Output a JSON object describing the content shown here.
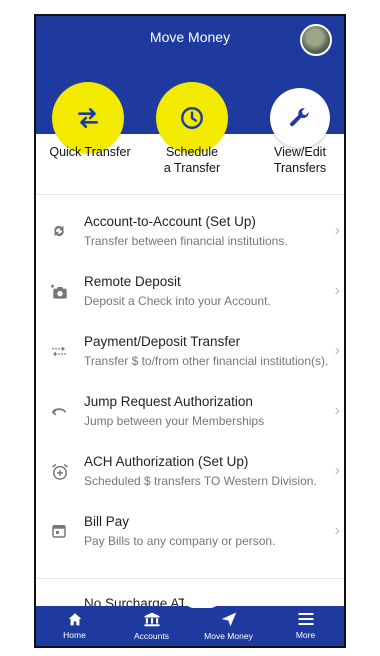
{
  "header": {
    "title": "Move Money"
  },
  "quick_actions": [
    {
      "label_line1": "Quick Transfer",
      "label_line2": "",
      "icon": "swap-arrows-icon"
    },
    {
      "label_line1": "Schedule",
      "label_line2": "a Transfer",
      "icon": "clock-icon"
    },
    {
      "label_line1": "View/Edit",
      "label_line2": "Transfers",
      "icon": "wrench-icon"
    }
  ],
  "menu": [
    {
      "title": "Account-to-Account (Set Up)",
      "subtitle": "Transfer between financial institutions.",
      "icon": "sync-arrows-icon"
    },
    {
      "title": "Remote Deposit",
      "subtitle": "Deposit a Check into your Account.",
      "icon": "camera-plus-icon"
    },
    {
      "title": "Payment/Deposit Transfer",
      "subtitle": "Transfer $ to/from other financial institution(s).",
      "icon": "dotted-swap-icon"
    },
    {
      "title": "Jump Request Authorization",
      "subtitle": "Jump between your Memberships",
      "icon": "jump-arrow-icon"
    },
    {
      "title": "ACH Authorization (Set Up)",
      "subtitle": "Scheduled $ transfers TO Western Division.",
      "icon": "alarm-plus-icon"
    },
    {
      "title": "Bill Pay",
      "subtitle": "Pay Bills to any company or person.",
      "icon": "calendar-icon"
    }
  ],
  "partial_item": "No Surcharge ATMs",
  "tabs": [
    {
      "label": "Home",
      "icon": "home-icon"
    },
    {
      "label": "Accounts",
      "icon": "bank-icon"
    },
    {
      "label": "Move Money",
      "icon": "send-arrow-icon"
    },
    {
      "label": "More",
      "icon": "menu-icon"
    }
  ],
  "colors": {
    "brand": "#1e3a9e",
    "highlight": "#f2ea00"
  }
}
